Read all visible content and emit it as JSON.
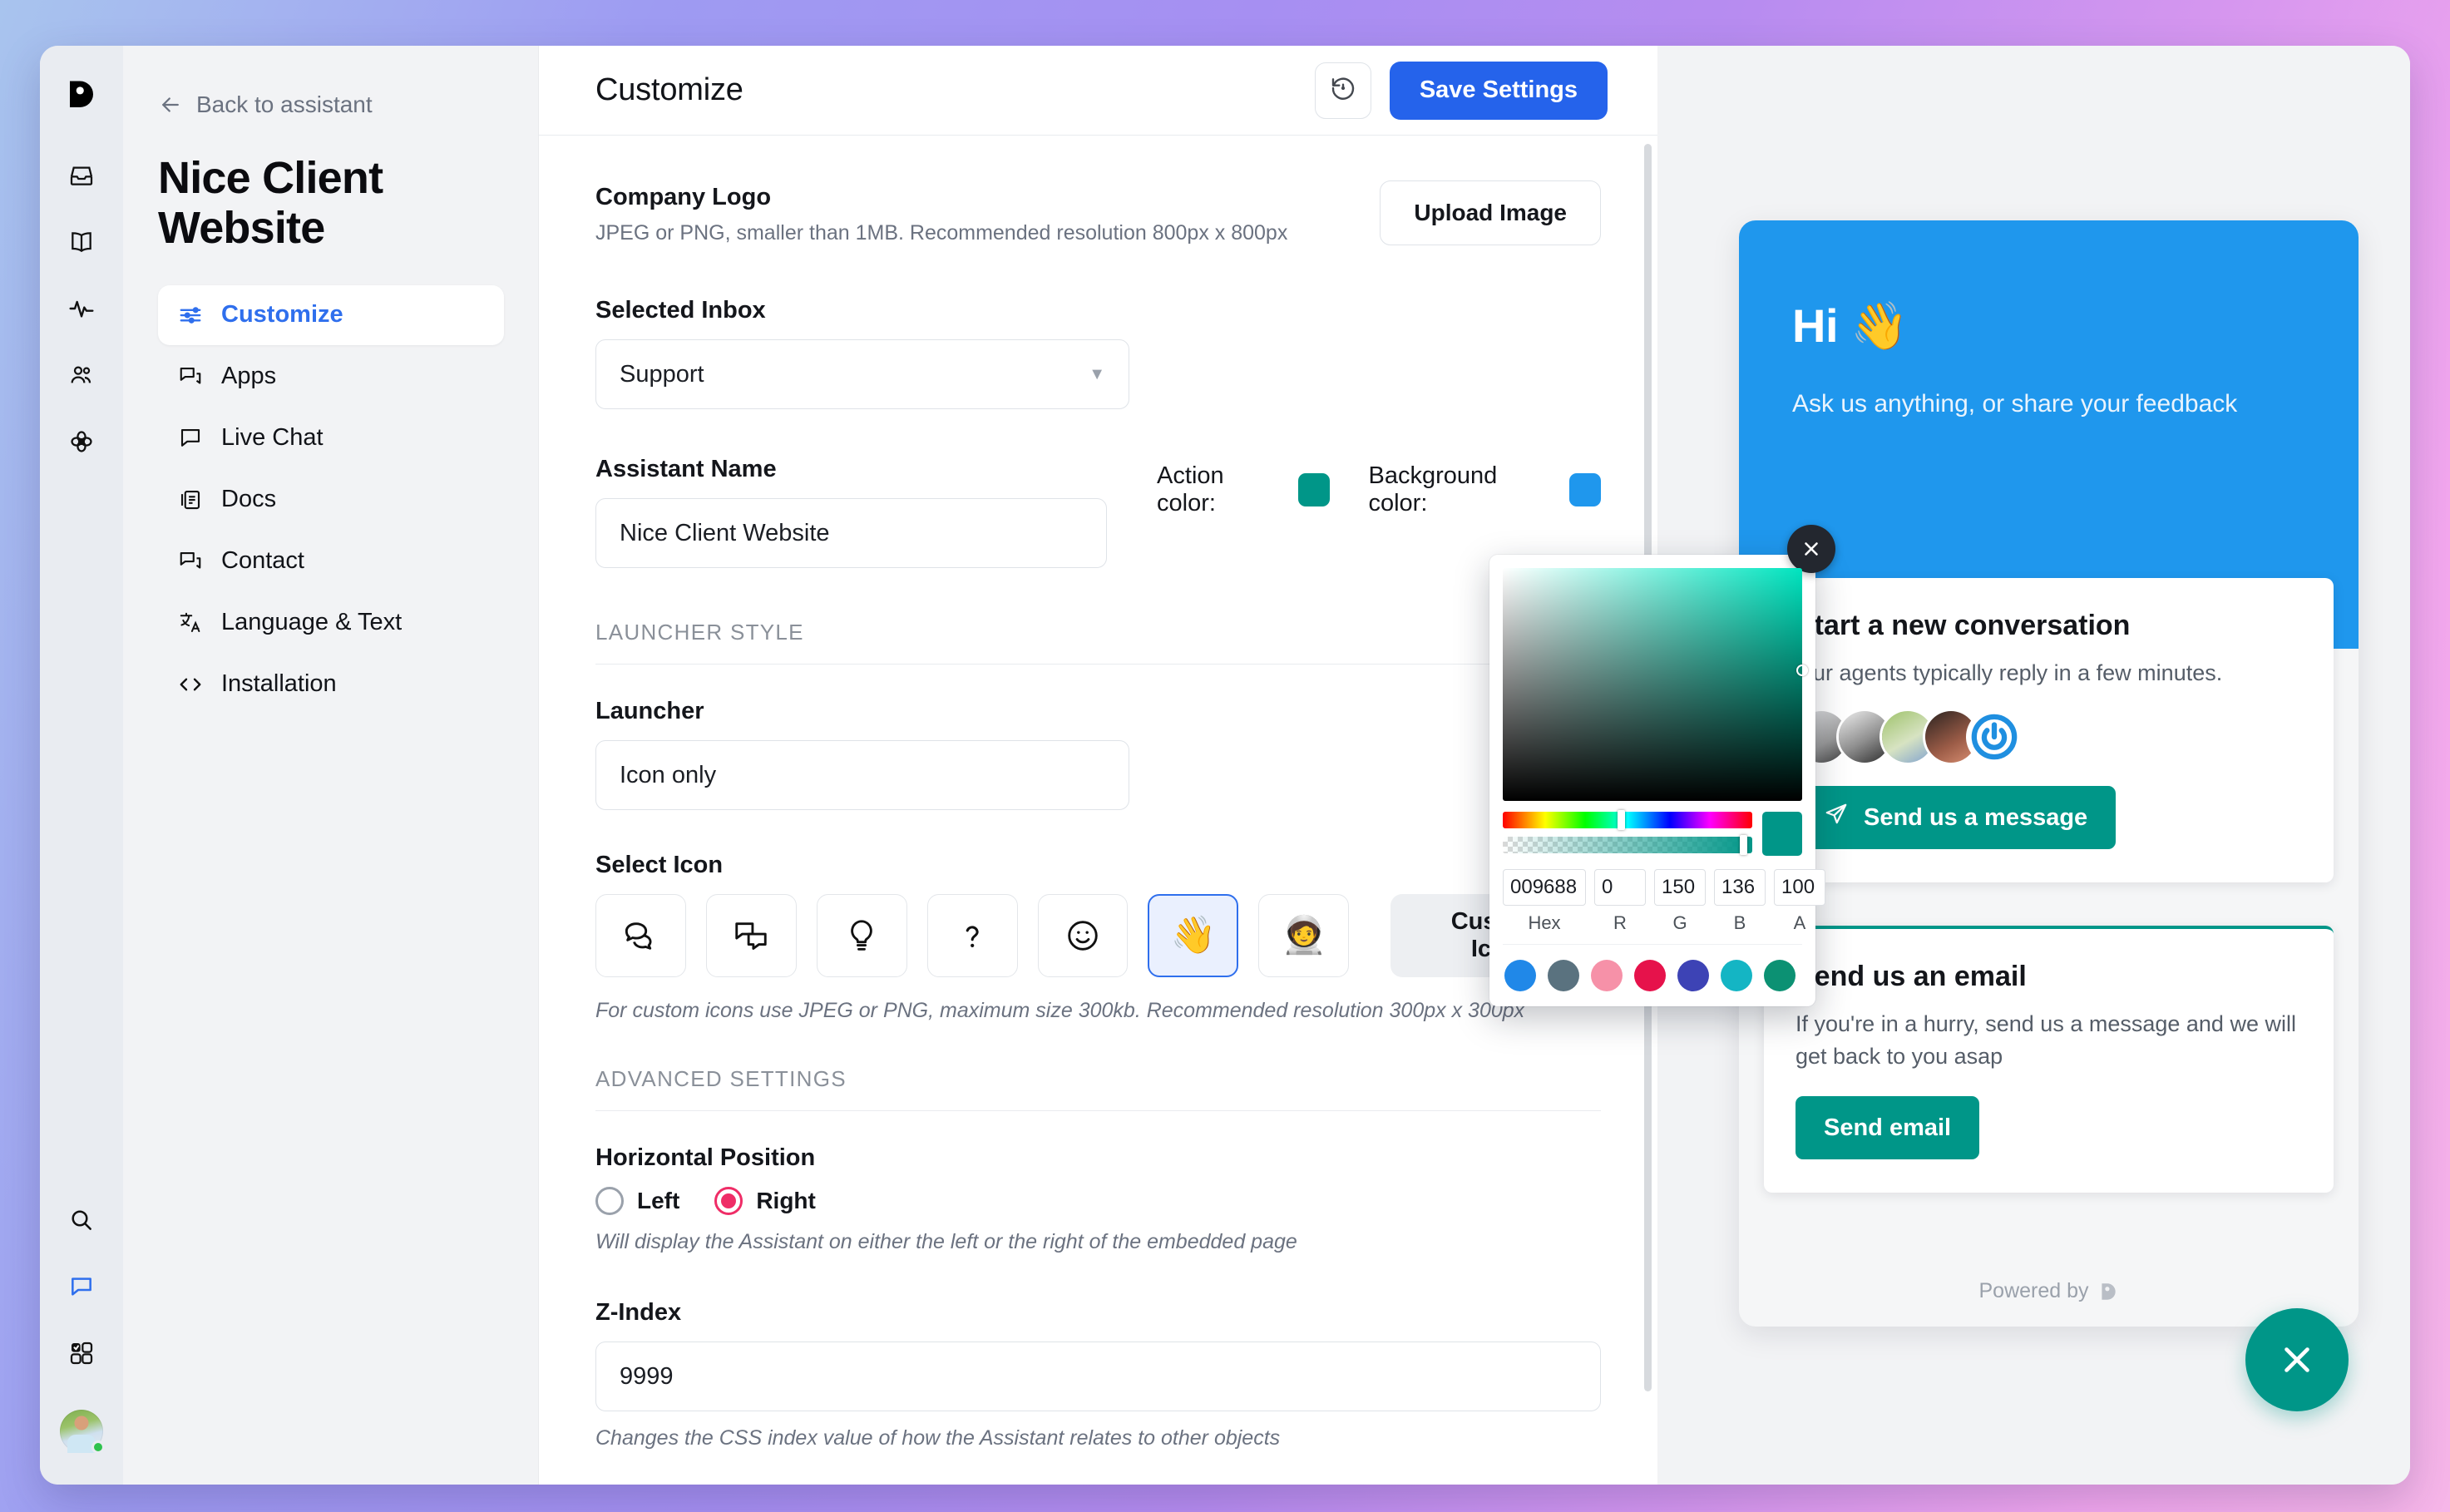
{
  "rail": {
    "logo": "dixa-logo",
    "icons": [
      "inbox-icon",
      "book-icon",
      "analytics-icon",
      "contacts-icon",
      "integrations-icon"
    ],
    "bottom_icons": [
      "search-icon",
      "chat-icon",
      "apps-grid-icon"
    ],
    "avatar": "user-avatar"
  },
  "nav": {
    "back_label": "Back to assistant",
    "assistant_name": "Nice Client Website",
    "items": [
      {
        "label": "Customize",
        "icon": "sliders-icon",
        "active": true
      },
      {
        "label": "Apps",
        "icon": "apps-icon",
        "active": false
      },
      {
        "label": "Live Chat",
        "icon": "chat-icon",
        "active": false
      },
      {
        "label": "Docs",
        "icon": "docs-icon",
        "active": false
      },
      {
        "label": "Contact",
        "icon": "contact-icon",
        "active": false
      },
      {
        "label": "Language & Text",
        "icon": "translate-icon",
        "active": false
      },
      {
        "label": "Installation",
        "icon": "code-icon",
        "active": false
      }
    ]
  },
  "panel": {
    "title": "Customize",
    "reset_icon": "history-reset-icon",
    "save_label": "Save Settings",
    "logo": {
      "label": "Company Logo",
      "hint": "JPEG or PNG, smaller than 1MB. Recommended resolution 800px x 800px",
      "upload_label": "Upload Image"
    },
    "inbox": {
      "label": "Selected Inbox",
      "value": "Support"
    },
    "assistant_name": {
      "label": "Assistant Name",
      "value": "Nice Client Website"
    },
    "action_color": {
      "label": "Action color:",
      "value": "#009688"
    },
    "background_color": {
      "label": "Background color:",
      "value": "#1f97ed"
    },
    "launcher_section": "LAUNCHER STYLE",
    "launcher": {
      "label": "Launcher",
      "value": "Icon only"
    },
    "select_icon": {
      "label": "Select Icon",
      "tiles": [
        {
          "icon": "speech-bubbles-icon",
          "glyph": "",
          "selected": false
        },
        {
          "icon": "chat-squares-icon",
          "glyph": "",
          "selected": false
        },
        {
          "icon": "lightbulb-icon",
          "glyph": "",
          "selected": false
        },
        {
          "icon": "question-mark-icon",
          "glyph": "",
          "selected": false
        },
        {
          "icon": "smiley-icon",
          "glyph": "",
          "selected": false
        },
        {
          "icon": "emoji-wave-icon",
          "glyph": "",
          "selected": true
        },
        {
          "icon": "emoji-astronaut-icon",
          "glyph": "🧑‍🚀",
          "selected": false
        }
      ],
      "custom_label": "Custom Icon",
      "hint": "For custom icons use JPEG or PNG, maximum size 300kb. Recommended resolution 300px x 300px"
    },
    "advanced_section": "ADVANCED SETTINGS",
    "horizontal_position": {
      "label": "Horizontal Position",
      "options": [
        {
          "label": "Left",
          "selected": false
        },
        {
          "label": "Right",
          "selected": true
        }
      ],
      "hint": "Will display the Assistant on either the left or the right of the embedded page"
    },
    "z_index": {
      "label": "Z-Index",
      "value": "9999",
      "hint": "Changes the CSS index value of how the Assistant relates to other objects"
    }
  },
  "picker": {
    "hex": "009688",
    "r": "0",
    "g": "150",
    "b": "136",
    "a": "100",
    "caps": {
      "hex": "Hex",
      "r": "R",
      "g": "G",
      "b": "B",
      "a": "A"
    },
    "close_icon": "close-icon",
    "swatches": [
      "#2088e8",
      "#5a727f",
      "#f691a8",
      "#e6124b",
      "#3d43b5",
      "#14b5c4",
      "#0c9173"
    ]
  },
  "preview": {
    "hero_title": "Hi 👋",
    "hero_sub": "Ask us anything, or share your feedback",
    "conversation": {
      "title": "Start a new conversation",
      "sub": "Our agents typically reply in a few minutes.",
      "avatar_count": 5,
      "button_label": "Send us a message",
      "button_icon": "send-icon"
    },
    "email": {
      "title": "Send us an email",
      "sub": "If you're in a hurry, send us a message and we will get back to you asap",
      "button_label": "Send email"
    },
    "powered_by": "Powered by",
    "launcher_icon": "close-icon"
  }
}
